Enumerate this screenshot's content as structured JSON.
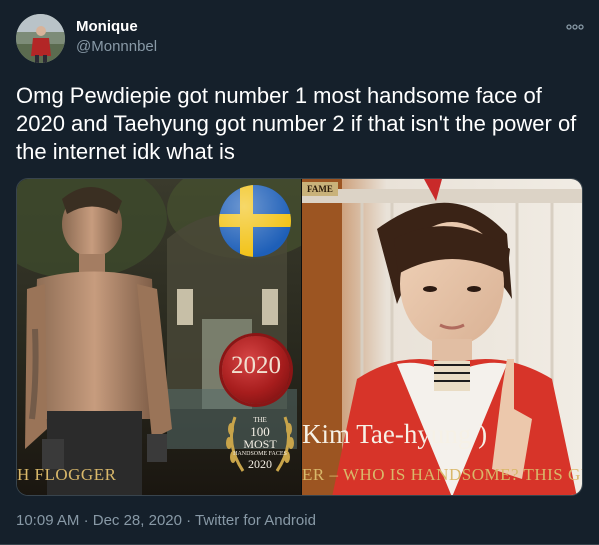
{
  "user": {
    "display_name": "Monique",
    "handle": "@Monnnbel"
  },
  "tweet": {
    "text": "Omg Pewdiepie got number 1 most handsome face of 2020 and Taehyung got number 2 if that isn't the power of the internet idk what is"
  },
  "media": {
    "left": {
      "seal_year": "2020",
      "award_line1": "THE",
      "award_line2": "100",
      "award_line3": "MOST",
      "award_line4": "HANDSOME FACES",
      "award_line5": "2020",
      "caption": "H FLOGGER"
    },
    "right": {
      "tag": "FAME",
      "name_caption": "Kim Tae-hyung )",
      "caption": "ER – WHO IS HANDSOME?  THIS GUY"
    }
  },
  "meta": {
    "time": "10:09 AM",
    "date": "Dec 28, 2020",
    "source": "Twitter for Android",
    "separator": "·"
  },
  "colors": {
    "background": "#15202b",
    "secondary_text": "#8899a6",
    "border": "#38444d"
  },
  "icons": {
    "more": "more-horizontal-icon",
    "flag": "sweden-flag-icon"
  }
}
